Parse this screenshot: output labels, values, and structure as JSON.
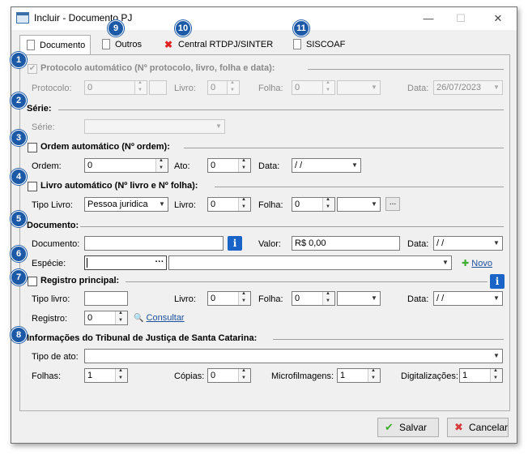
{
  "window": {
    "title": "Incluir - Documento PJ",
    "minimize": "—",
    "maximize": "☐",
    "close": "✕"
  },
  "tabs": [
    {
      "label": "Documento"
    },
    {
      "label": "Outros"
    },
    {
      "label": "Central RTDPJ/SINTER"
    },
    {
      "label": "SISCOAF"
    }
  ],
  "badges": [
    "1",
    "2",
    "3",
    "4",
    "5",
    "6",
    "7",
    "8",
    "9",
    "10",
    "11"
  ],
  "protocolo": {
    "section": "Protocolo automático (Nº protocolo, livro, folha e data):",
    "checkbox": "✔",
    "protocolo_label": "Protocolo:",
    "protocolo_value": "0",
    "livro_label": "Livro:",
    "livro_value": "0",
    "folha_label": "Folha:",
    "folha_value": "0",
    "data_label": "Data:",
    "data_value": "26/07/2023"
  },
  "serie": {
    "section": "Série:",
    "serie_label": "Série:",
    "serie_value": ""
  },
  "ordem": {
    "section": "Ordem automático (Nº ordem):",
    "ordem_label": "Ordem:",
    "ordem_value": "0",
    "ato_label": "Ato:",
    "ato_value": "0",
    "data_label": "Data:",
    "data_value": " / /"
  },
  "livro": {
    "section": "Livro automático (Nº livro e Nº folha):",
    "tipo_label": "Tipo Livro:",
    "tipo_value": "Pessoa juridica",
    "livro_label": "Livro:",
    "livro_value": "0",
    "folha_label": "Folha:",
    "folha_value": "0",
    "ellipsis": "..."
  },
  "documento": {
    "section": "Documento:",
    "documento_label": "Documento:",
    "documento_value": "",
    "valor_label": "Valor:",
    "valor_value": "R$ 0,00",
    "data_label": "Data:",
    "data_value": " / /",
    "especie_label": "Espécie:",
    "especie_code": "",
    "especie_value": "",
    "ellipsis": "···",
    "novo_label": "Novo",
    "info": "i"
  },
  "registro": {
    "section": "Registro principal:",
    "tipo_livro_label": "Tipo livro:",
    "tipo_livro_value": "",
    "livro_label": "Livro:",
    "livro_value": "0",
    "folha_label": "Folha:",
    "folha_value": "0",
    "data_label": "Data:",
    "data_value": " / /",
    "registro_label": "Registro:",
    "registro_value": "0",
    "consultar_label": "Consultar",
    "info": "i"
  },
  "tjsc": {
    "section": "Informações do Tribunal de Justiça de Santa Catarina:",
    "tipo_ato_label": "Tipo de ato:",
    "tipo_ato_value": "",
    "folhas_label": "Folhas:",
    "folhas_value": "1",
    "copias_label": "Cópias:",
    "copias_value": "0",
    "micro_label": "Microfilmagens:",
    "micro_value": "1",
    "digit_label": "Digitalizações:",
    "digit_value": "1"
  },
  "footer": {
    "salvar": "Salvar",
    "cancelar": "Cancelar"
  },
  "icons": {
    "check": "✔",
    "cross": "✖",
    "plus": "✚",
    "magnifier": "🔍",
    "dropdown": "▼"
  }
}
